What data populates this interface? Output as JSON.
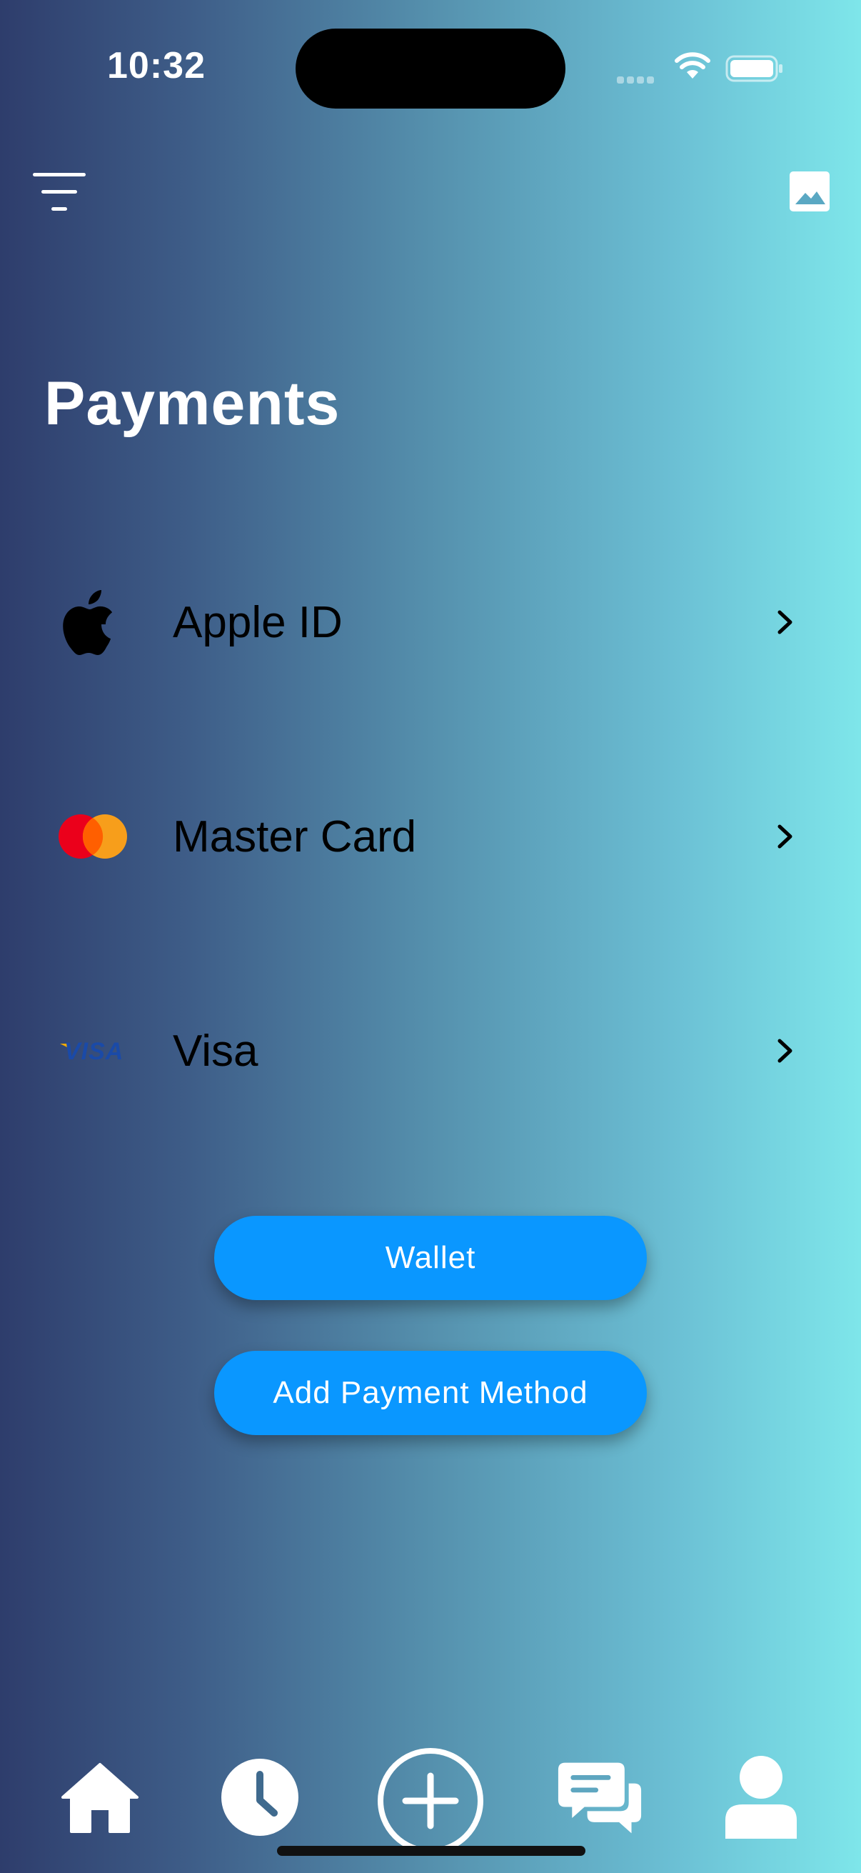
{
  "status_bar": {
    "time": "10:32"
  },
  "toolbar": {
    "left_icon": "filter-icon",
    "right_icon": "image-icon"
  },
  "page": {
    "title": "Payments"
  },
  "payment_methods": [
    {
      "label": "Apple ID",
      "icon": "apple-logo-icon"
    },
    {
      "label": "Master Card",
      "icon": "mastercard-logo-icon"
    },
    {
      "label": "Visa",
      "icon": "visa-logo-icon",
      "logo_text": "VISA"
    }
  ],
  "buttons": {
    "wallet": "Wallet",
    "add_payment_method": "Add Payment Method"
  },
  "tab_bar": {
    "items": [
      "home-icon",
      "clock-icon",
      "add-icon",
      "messages-icon",
      "profile-icon"
    ]
  },
  "colors": {
    "button": "#0a97ff",
    "gradient_start": "#2e3d6c",
    "gradient_end": "#7ee6ea",
    "mastercard_red": "#eb001b",
    "mastercard_orange": "#f79e1b",
    "visa_blue": "#1a4aa8",
    "visa_gold": "#f2a900"
  }
}
